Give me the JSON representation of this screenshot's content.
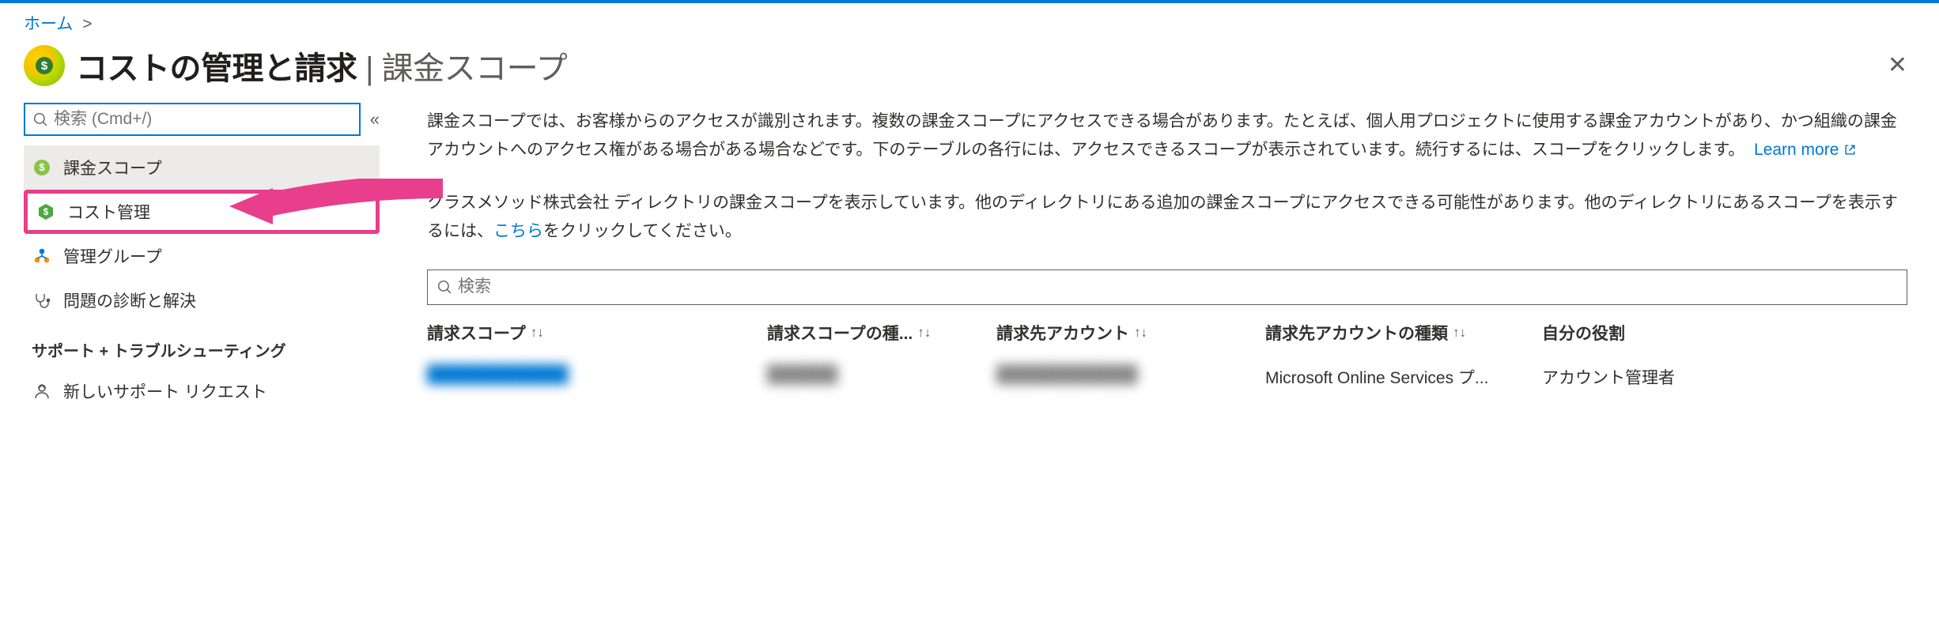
{
  "breadcrumb": {
    "home": "ホーム"
  },
  "header": {
    "title_main": "コストの管理と請求",
    "title_sub": " | 課金スコープ"
  },
  "sidebar": {
    "search_placeholder": "検索 (Cmd+/)",
    "collapse_symbol": "«",
    "items": [
      {
        "label": "課金スコープ"
      },
      {
        "label": "コスト管理"
      },
      {
        "label": "管理グループ"
      },
      {
        "label": "問題の診断と解決"
      }
    ],
    "section": "サポート + トラブルシューティング",
    "support_item": "新しいサポート リクエスト"
  },
  "main": {
    "para1_prefix": "課金スコープでは、お客様からのアクセスが識別されます。複数の課金スコープにアクセスできる場合があります。たとえば、個人用プロジェクトに使用する課金アカウントがあり、かつ組織の課金アカウントへのアクセス権がある場合がある場合などです。下のテーブルの各行には、アクセスできるスコープが表示されています。続行するには、スコープをクリックします。",
    "learn_more": "Learn more",
    "para2_prefix": "クラスメソッド株式会社 ディレクトリの課金スコープを表示しています。他のディレクトリにある追加の課金スコープにアクセスできる可能性があります。他のディレクトリにあるスコープを表示するには、",
    "para2_link": "こちら",
    "para2_suffix": "をクリックしてください。",
    "table_search_placeholder": "検索",
    "columns": {
      "c1": "請求スコープ",
      "c2": "請求スコープの種...",
      "c3": "請求先アカウント",
      "c4": "請求先アカウントの種類",
      "c5": "自分の役割"
    },
    "row": {
      "c1": "████████████",
      "c2": "██████",
      "c3": "████████████",
      "c4": "Microsoft Online Services プ...",
      "c5": "アカウント管理者"
    }
  }
}
